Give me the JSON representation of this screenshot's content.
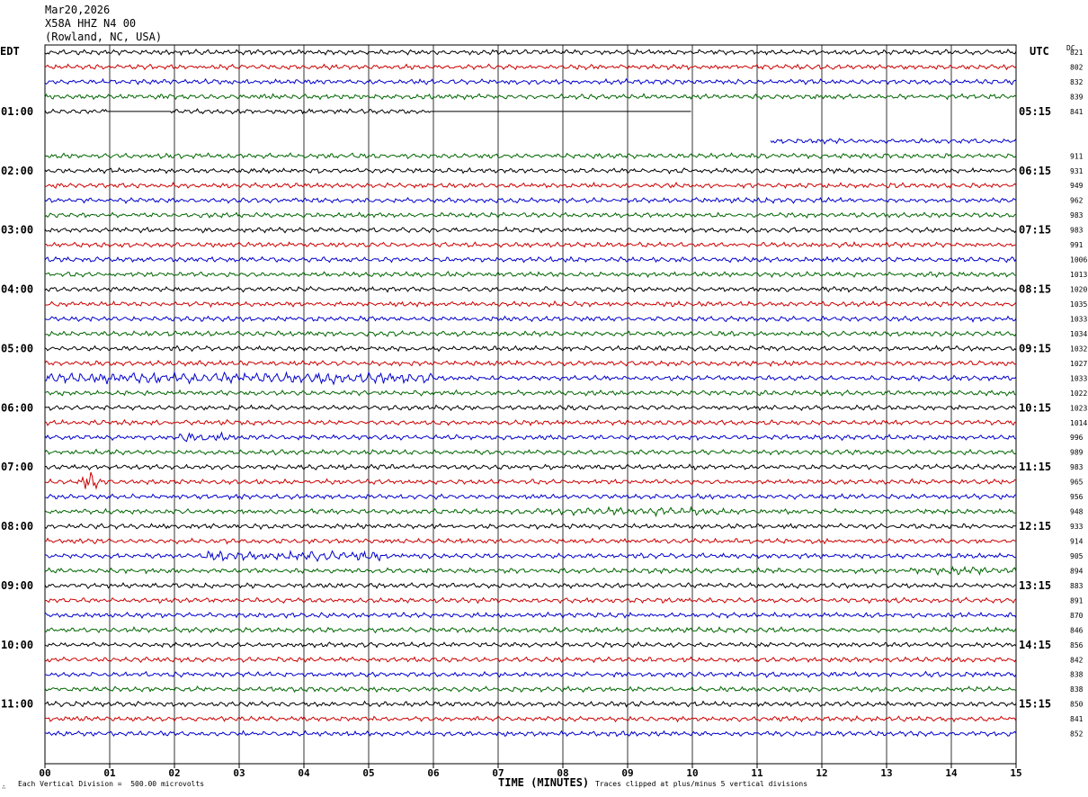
{
  "header": {
    "date": "Mar20,2026",
    "station": "X58A HHZ N4 00",
    "location": "(Rowland, NC, USA)"
  },
  "tz_left": "EDT",
  "tz_right": "UTC",
  "dc_label": "DC",
  "corner_mark": "∴",
  "footer": {
    "scale_note": "Each Vertical Division =  500.00 microvolts",
    "clip_note": "Traces clipped at plus/minus 5 vertical divisions",
    "xlabel": "TIME (MINUTES)"
  },
  "colors": {
    "trace_cycle": [
      "#000000",
      "#cc0000",
      "#0000cc",
      "#006600"
    ],
    "grid": "#000000"
  },
  "chart_data": {
    "type": "line",
    "title": "X58A HHZ N4 00",
    "xlabel": "TIME (MINUTES)",
    "ylabel": "",
    "xlim": [
      0,
      15
    ],
    "x_ticks": [
      "00",
      "01",
      "02",
      "03",
      "04",
      "05",
      "06",
      "07",
      "08",
      "09",
      "10",
      "11",
      "12",
      "13",
      "14",
      "15"
    ],
    "trace_minutes": 15,
    "traces_per_hour": 4,
    "left_hour_labels": [
      "01:00",
      "02:00",
      "03:00",
      "04:00",
      "05:00",
      "06:00",
      "07:00",
      "08:00",
      "09:00",
      "10:00",
      "11:00"
    ],
    "right_hour_labels": [
      "05:15",
      "06:15",
      "07:15",
      "08:15",
      "09:15",
      "10:15",
      "11:15",
      "12:15",
      "13:15",
      "14:15",
      "15:15"
    ],
    "dc_offsets": [
      821,
      802,
      832,
      839,
      841,
      null,
      null,
      911,
      931,
      949,
      962,
      983,
      983,
      991,
      1006,
      1013,
      1020,
      1035,
      1033,
      1034,
      1032,
      1027,
      1033,
      1022,
      1023,
      1014,
      996,
      989,
      983,
      965,
      956,
      948,
      933,
      914,
      905,
      894,
      883,
      891,
      870,
      846,
      856,
      842,
      838,
      838,
      850,
      841,
      852
    ],
    "data_gaps": [
      {
        "trace": 4,
        "from_min": 0.95,
        "to_min": 1.95
      },
      {
        "trace": 4,
        "from_min": 5.95,
        "to_min": 10.0
      },
      {
        "trace": 4,
        "from_min": 10.0,
        "to_min": 15.0
      },
      {
        "trace": 5,
        "from_min": 0,
        "to_min": 15.0
      },
      {
        "trace": 6,
        "from_min": 0,
        "to_min": 11.2
      }
    ],
    "events": [
      {
        "trace": 22,
        "from_min": 0,
        "to_min": 6.0,
        "amp": 2.2
      },
      {
        "trace": 26,
        "from_min": 2.0,
        "to_min": 2.8,
        "amp": 1.8
      },
      {
        "trace": 29,
        "from_min": 0.55,
        "to_min": 0.8,
        "amp": 5.5
      },
      {
        "trace": 31,
        "from_min": 7.5,
        "to_min": 10.5,
        "amp": 1.6
      },
      {
        "trace": 34,
        "from_min": 2.5,
        "to_min": 5.2,
        "amp": 2.0
      },
      {
        "trace": 35,
        "from_min": 13.3,
        "to_min": 15.0,
        "amp": 1.5
      }
    ]
  }
}
